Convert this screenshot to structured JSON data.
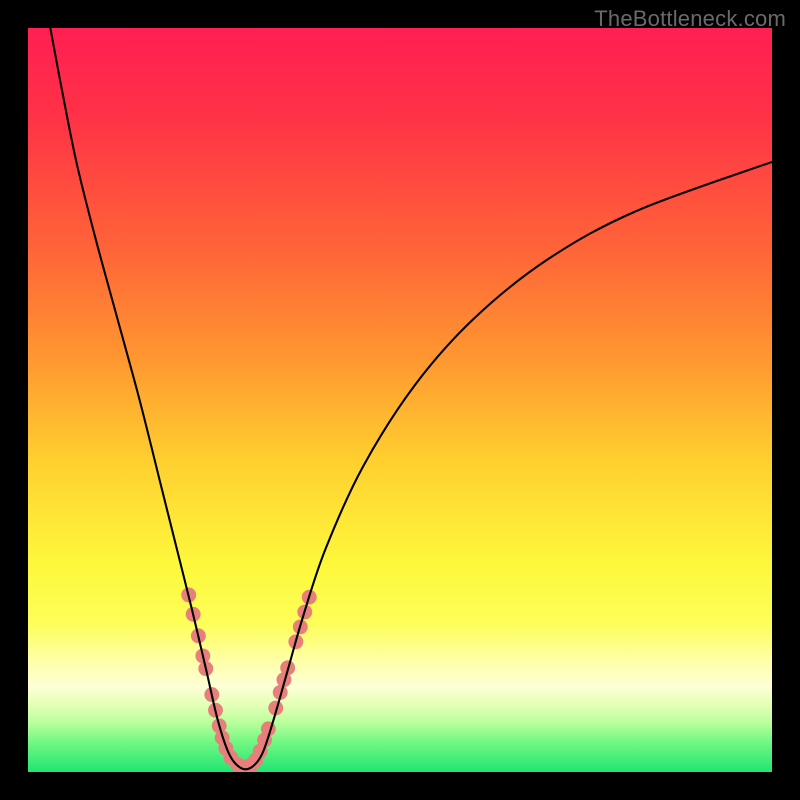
{
  "watermark": "TheBottleneck.com",
  "chart_data": {
    "type": "line",
    "title": "",
    "xlabel": "",
    "ylabel": "",
    "xlim": [
      0,
      100
    ],
    "ylim": [
      0,
      100
    ],
    "background_gradient_stops": [
      {
        "offset": 0.0,
        "color": "#ff1f53"
      },
      {
        "offset": 0.12,
        "color": "#ff3246"
      },
      {
        "offset": 0.3,
        "color": "#ff6538"
      },
      {
        "offset": 0.45,
        "color": "#ff9930"
      },
      {
        "offset": 0.58,
        "color": "#ffcf2f"
      },
      {
        "offset": 0.72,
        "color": "#fdf83b"
      },
      {
        "offset": 0.8,
        "color": "#fdfe58"
      },
      {
        "offset": 0.85,
        "color": "#feffa6"
      },
      {
        "offset": 0.885,
        "color": "#fdffd6"
      },
      {
        "offset": 0.91,
        "color": "#e3ffb5"
      },
      {
        "offset": 0.935,
        "color": "#b6ff9a"
      },
      {
        "offset": 0.96,
        "color": "#71f782"
      },
      {
        "offset": 1.0,
        "color": "#20e573"
      }
    ],
    "series": [
      {
        "name": "bottleneck-curve",
        "color": "#000000",
        "points": [
          {
            "x": 3.0,
            "y": 100.0
          },
          {
            "x": 4.5,
            "y": 92.0
          },
          {
            "x": 6.5,
            "y": 82.0
          },
          {
            "x": 9.0,
            "y": 72.0
          },
          {
            "x": 12.0,
            "y": 61.0
          },
          {
            "x": 15.0,
            "y": 50.0
          },
          {
            "x": 18.0,
            "y": 38.0
          },
          {
            "x": 20.0,
            "y": 30.0
          },
          {
            "x": 22.0,
            "y": 22.0
          },
          {
            "x": 24.0,
            "y": 13.5
          },
          {
            "x": 25.5,
            "y": 7.0
          },
          {
            "x": 27.0,
            "y": 2.5
          },
          {
            "x": 28.5,
            "y": 0.6
          },
          {
            "x": 30.0,
            "y": 0.6
          },
          {
            "x": 31.5,
            "y": 2.5
          },
          {
            "x": 33.0,
            "y": 7.0
          },
          {
            "x": 35.0,
            "y": 14.0
          },
          {
            "x": 37.0,
            "y": 21.0
          },
          {
            "x": 40.0,
            "y": 30.0
          },
          {
            "x": 45.0,
            "y": 41.0
          },
          {
            "x": 52.0,
            "y": 52.0
          },
          {
            "x": 60.0,
            "y": 61.0
          },
          {
            "x": 70.0,
            "y": 69.0
          },
          {
            "x": 82.0,
            "y": 75.5
          },
          {
            "x": 100.0,
            "y": 82.0
          }
        ]
      }
    ],
    "highlight_dots": {
      "color": "#e77f7b",
      "radius_pct": 1.0,
      "points": [
        {
          "x": 21.6,
          "y": 23.8
        },
        {
          "x": 22.2,
          "y": 21.2
        },
        {
          "x": 22.9,
          "y": 18.3
        },
        {
          "x": 23.5,
          "y": 15.6
        },
        {
          "x": 23.9,
          "y": 13.9
        },
        {
          "x": 24.7,
          "y": 10.4
        },
        {
          "x": 25.2,
          "y": 8.3
        },
        {
          "x": 25.7,
          "y": 6.2
        },
        {
          "x": 26.1,
          "y": 4.6
        },
        {
          "x": 26.6,
          "y": 3.2
        },
        {
          "x": 27.3,
          "y": 1.9
        },
        {
          "x": 28.2,
          "y": 1.0
        },
        {
          "x": 29.2,
          "y": 0.7
        },
        {
          "x": 30.1,
          "y": 1.0
        },
        {
          "x": 30.6,
          "y": 1.6
        },
        {
          "x": 31.2,
          "y": 2.8
        },
        {
          "x": 31.8,
          "y": 4.3
        },
        {
          "x": 32.3,
          "y": 5.8
        },
        {
          "x": 33.3,
          "y": 8.6
        },
        {
          "x": 33.9,
          "y": 10.7
        },
        {
          "x": 34.4,
          "y": 12.4
        },
        {
          "x": 34.9,
          "y": 14.0
        },
        {
          "x": 36.0,
          "y": 17.5
        },
        {
          "x": 36.6,
          "y": 19.5
        },
        {
          "x": 37.2,
          "y": 21.5
        },
        {
          "x": 37.8,
          "y": 23.5
        }
      ]
    }
  }
}
